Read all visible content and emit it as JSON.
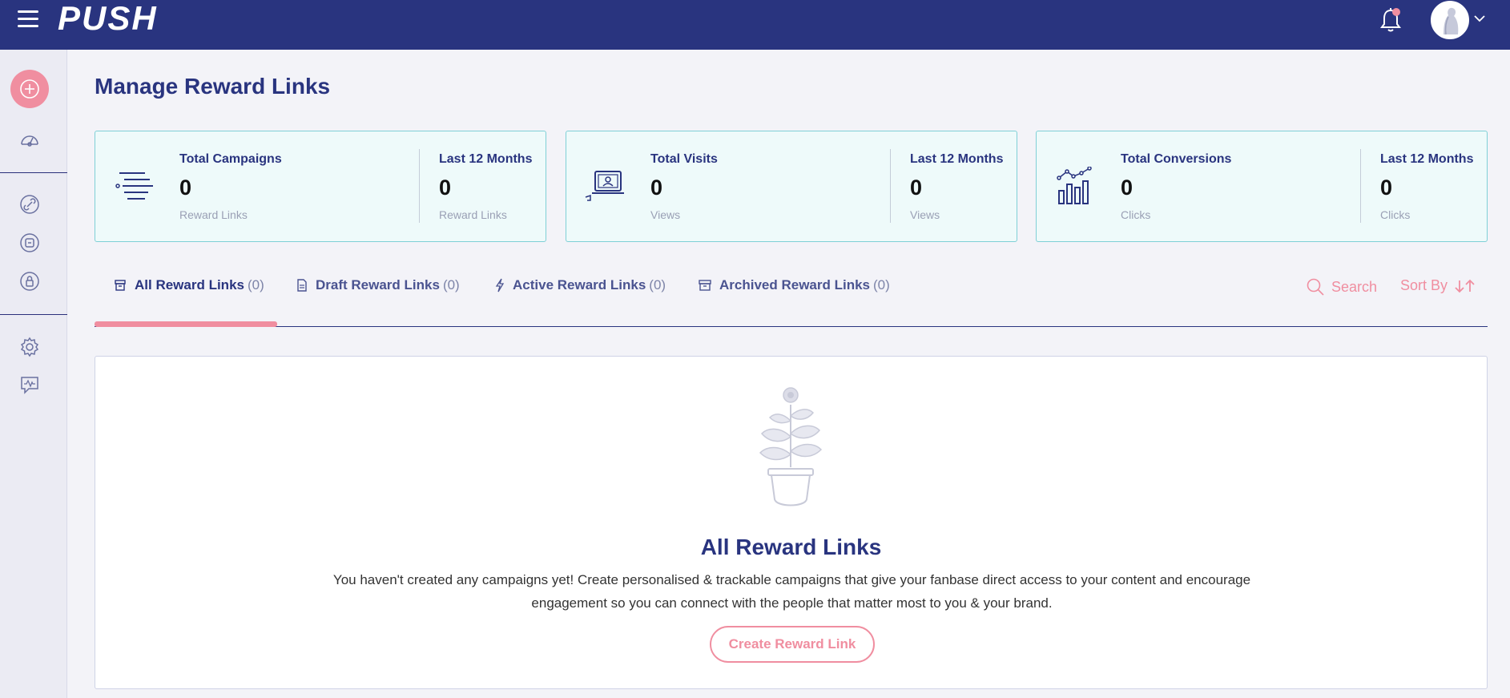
{
  "header": {
    "logo": "PUSH"
  },
  "page": {
    "title": "Manage Reward Links"
  },
  "stats": [
    {
      "title": "Total Campaigns",
      "value": "0",
      "sub": "Reward Links",
      "period_title": "Last 12 Months",
      "period_value": "0",
      "period_sub": "Reward Links",
      "icon": "list-lines-icon"
    },
    {
      "title": "Total Visits",
      "value": "0",
      "sub": "Views",
      "period_title": "Last 12 Months",
      "period_value": "0",
      "period_sub": "Views",
      "icon": "laptop-icon"
    },
    {
      "title": "Total Conversions",
      "value": "0",
      "sub": "Clicks",
      "period_title": "Last 12 Months",
      "period_value": "0",
      "period_sub": "Clicks",
      "icon": "bar-chart-icon"
    }
  ],
  "tabs": [
    {
      "label": "All Reward Links",
      "count": "(0)",
      "icon": "archive-icon"
    },
    {
      "label": "Draft Reward Links",
      "count": "(0)",
      "icon": "document-icon"
    },
    {
      "label": "Active Reward Links",
      "count": "(0)",
      "icon": "lightning-icon"
    },
    {
      "label": "Archived Reward Links",
      "count": "(0)",
      "icon": "box-icon"
    }
  ],
  "toolbar": {
    "search_label": "Search",
    "sort_label": "Sort By"
  },
  "empty_state": {
    "title": "All Reward Links",
    "description": "You haven't created any campaigns yet! Create personalised & trackable campaigns that give your fanbase direct access to your content and encourage engagement so you can connect with the people that matter most to you & your brand.",
    "button_label": "Create Reward Link"
  },
  "colors": {
    "brand": "#29347f",
    "accent": "#f08ea0",
    "card_bg": "#eefafa",
    "card_border": "#7fd0d6"
  }
}
